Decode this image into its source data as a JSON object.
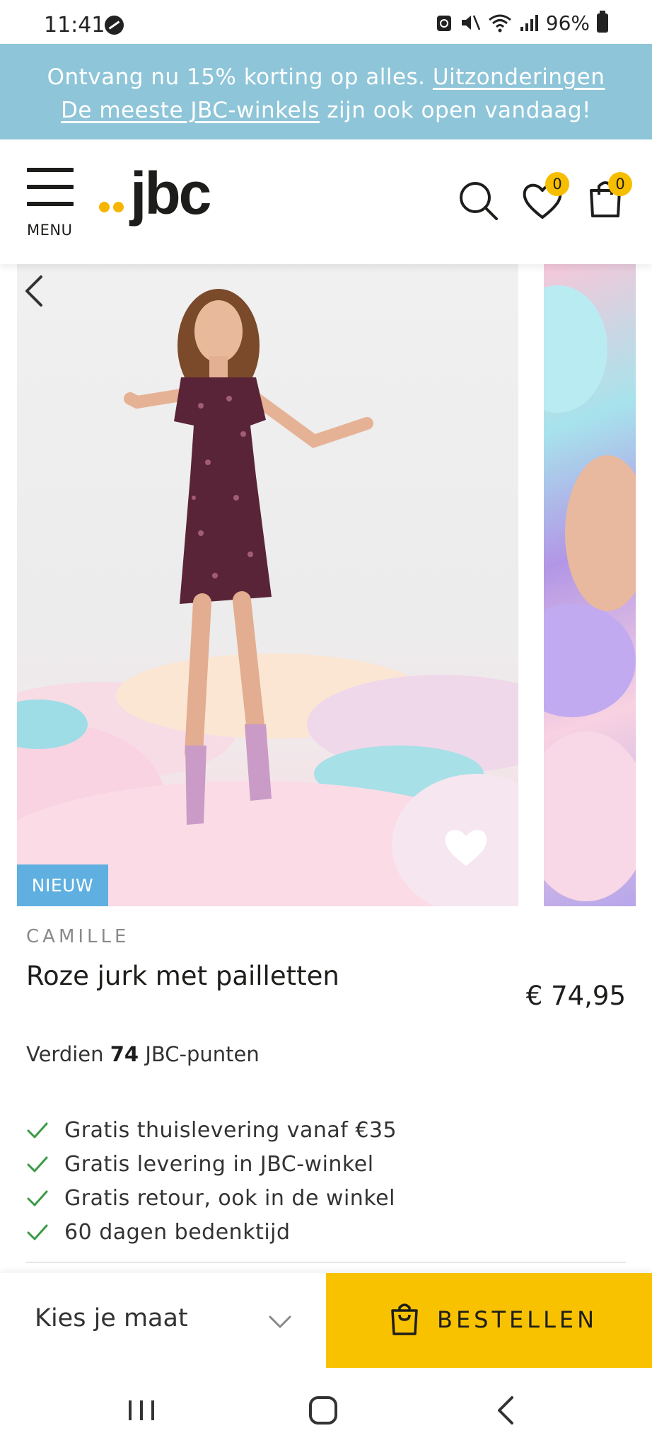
{
  "status_bar": {
    "time": "11:41",
    "battery": "96%"
  },
  "promo": {
    "line1_text": "Ontvang nu 15% korting op alles.",
    "line1_link": "Uitzonderingen",
    "line2_link": "De meeste JBC-winkels",
    "line2_text": "zijn ook open vandaag!"
  },
  "header": {
    "menu_label": "MENU",
    "logo_text": "jbc",
    "wishlist_count": "0",
    "cart_count": "0"
  },
  "product": {
    "badge": "NIEUW",
    "brand": "CAMILLE",
    "title": "Roze jurk met pailletten",
    "price": "€ 74,95",
    "points_prefix": "Verdien",
    "points_value": "74",
    "points_suffix": "JBC-punten",
    "usps": [
      "Gratis thuislevering vanaf €35",
      "Gratis levering in JBC-winkel",
      "Gratis retour, ook in de winkel",
      "60 dagen bedenktijd"
    ]
  },
  "actions": {
    "size_placeholder": "Kies je maat",
    "order_label": "BESTELLEN"
  },
  "colors": {
    "promo_bg": "#8ec5d8",
    "accent_yellow": "#f9c200",
    "badge_blue": "#5fb0e0",
    "check_green": "#3a9b45"
  }
}
